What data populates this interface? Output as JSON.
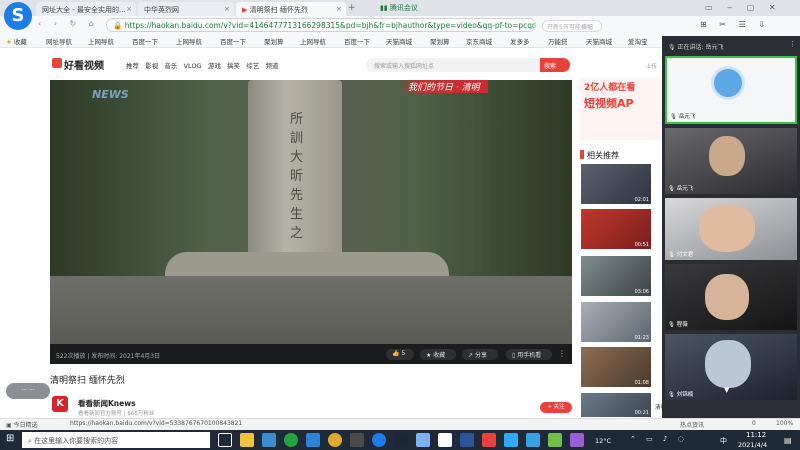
{
  "tabs": [
    {
      "label": "网址大全 - 最安全实用的..."
    },
    {
      "label": "中华英烈网"
    },
    {
      "label": "清明祭扫 缅怀先烈"
    }
  ],
  "top_right": {
    "meeting": "腾讯会议",
    "search_placeholder": "开新5万可能横幅"
  },
  "address": {
    "url": "https://haokan.baidu.com/v?vid=4146477713166298315&pd=bjh&fr=bjhauthor&type=video&qq-pf-to=pcqq"
  },
  "bookmarks": {
    "fav": "收藏",
    "items": [
      "网址导航",
      "上网导航",
      "百度一下",
      "上网导航",
      "百度一下",
      "聚划算",
      "上网导航",
      "百度一下",
      "天猫商城",
      "聚划算",
      "京东商城",
      "发多多",
      "万能贷",
      "天猫商城",
      "爱淘宝"
    ]
  },
  "site": {
    "name": "好看视频",
    "nav": [
      "推荐",
      "影视",
      "音乐",
      "VLOG",
      "游戏",
      "搞笑",
      "综艺",
      "频道"
    ],
    "search_placeholder": "搜索或输入搜狐网址点",
    "search_button": "搜索",
    "upload": "上传"
  },
  "video": {
    "overlay": "我们的节日 · 清明",
    "watermark": "NEWS",
    "carving": "所 訓 大 昕 先 生 之"
  },
  "controls": {
    "stats": "522次播放 | 发布时间: 2021年4月3日",
    "like_count": "5",
    "collect": "收藏",
    "share": "分享",
    "phone_watch": "用手机看"
  },
  "video_title": "清明祭扫 缅怀先烈",
  "author": {
    "logo": "K",
    "name": "看看新闻Knews",
    "meta": "看看新闻官方账号 | 665万粉丝",
    "follow": "+ 关注"
  },
  "ad": {
    "line1": "2亿人都在看",
    "line2": "短视频AP"
  },
  "recommend": {
    "title": "相关推荐",
    "items": [
      {
        "duration": "02:01",
        "text": "..."
      },
      {
        "duration": "00:51",
        "text": "..."
      },
      {
        "duration": "03:06",
        "text": "..."
      },
      {
        "duration": "01:23",
        "text": "..."
      },
      {
        "duration": "01:08",
        "text": "..."
      },
      {
        "duration": "00:33",
        "text": "..."
      },
      {
        "duration": "00:21",
        "text": "清明主题活动"
      }
    ]
  },
  "meeting": {
    "speaking_label": "正在讲话: 岳元飞",
    "participants": [
      {
        "name": "岳元飞"
      },
      {
        "name": "岳元飞"
      },
      {
        "name": "付文君"
      },
      {
        "name": "程薇"
      },
      {
        "name": "刘锦楠"
      }
    ]
  },
  "status": {
    "left": "今日精选",
    "url": "https://haokan.baidu.com/v?vid=5338767670100843821",
    "right1": "热点资讯",
    "count": "0",
    "zoom": "100%"
  },
  "taskbar": {
    "search": "在这里输入你要搜索的内容",
    "weather": "12°C",
    "ime": "中",
    "time": "11:12",
    "date": "2021/4/4"
  },
  "chat_bubble": "··· ···",
  "colors": {
    "brand_red": "#e8423a",
    "address_green": "#1c7c3f",
    "meeting_bg": "#2a2d33",
    "taskbar": "#1f2a38"
  }
}
